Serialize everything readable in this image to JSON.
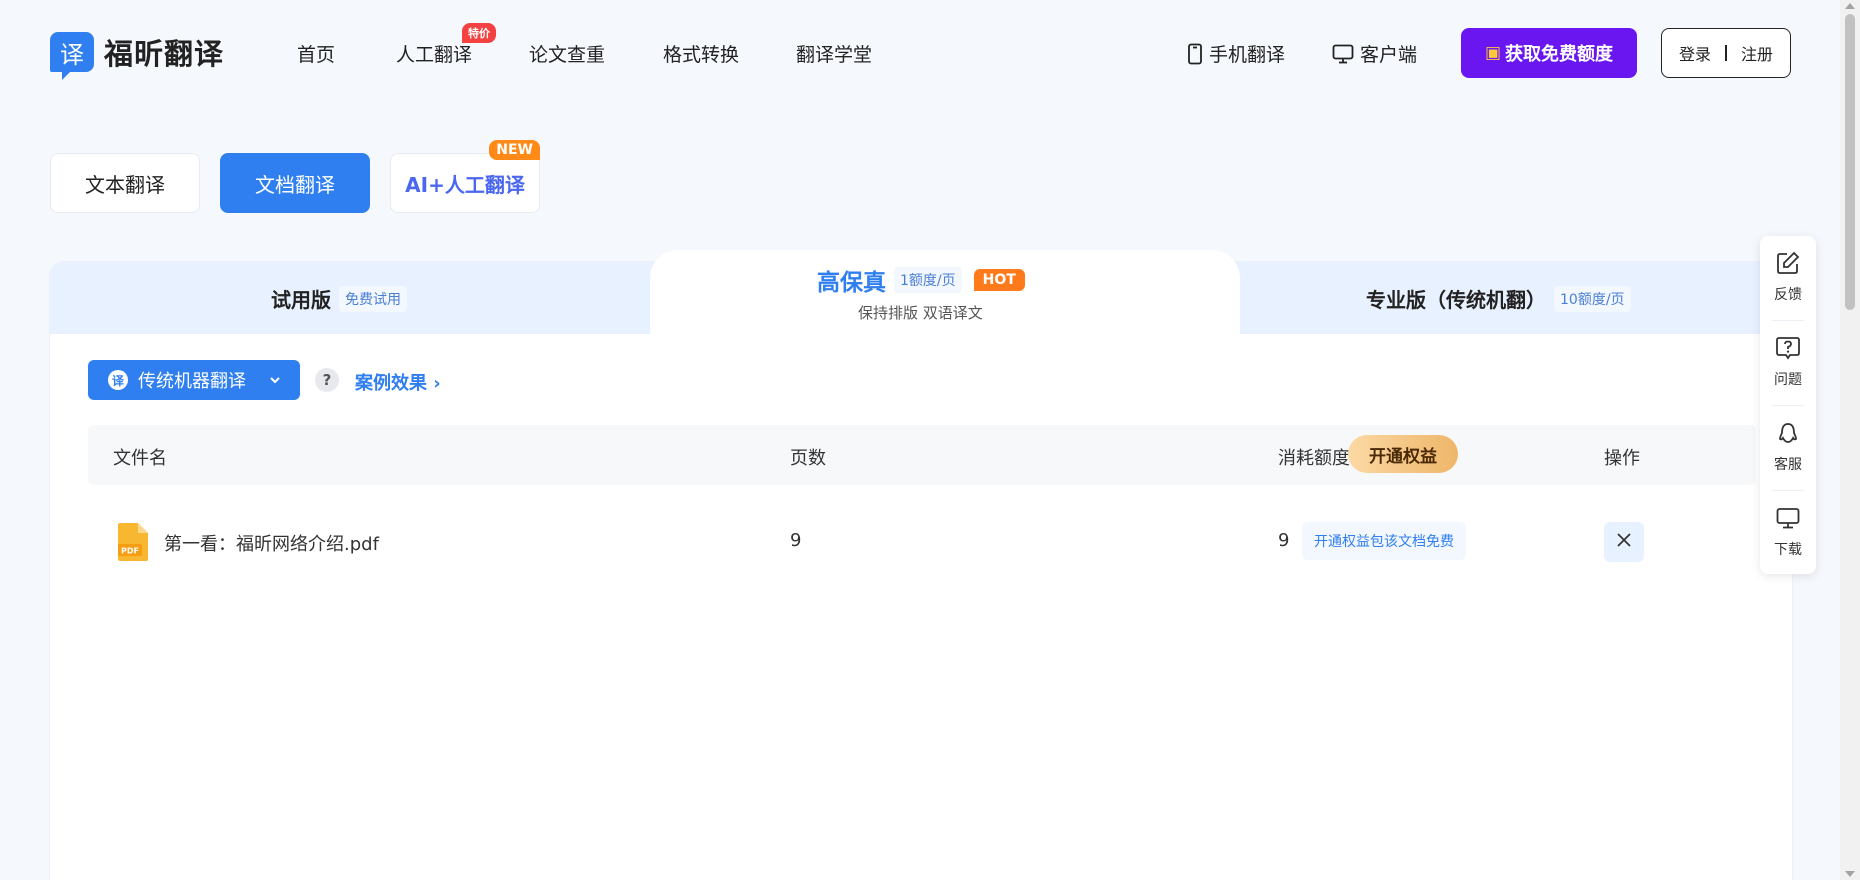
{
  "header": {
    "logo_glyph": "译",
    "logo_text": "福昕翻译",
    "nav": [
      {
        "label": "首页"
      },
      {
        "label": "人工翻译",
        "badge": "特价"
      },
      {
        "label": "论文查重"
      },
      {
        "label": "格式转换"
      },
      {
        "label": "翻译学堂"
      }
    ],
    "mobile_label": "手机翻译",
    "client_label": "客户端",
    "cta_label": "获取免费额度",
    "login_label": "登录",
    "register_label": "注册"
  },
  "modes": [
    {
      "label": "文本翻译",
      "active": false
    },
    {
      "label": "文档翻译",
      "active": true
    },
    {
      "label": "AI+人工翻译",
      "badge": "NEW"
    }
  ],
  "tiers": {
    "trial": {
      "title": "试用版",
      "tag": "免费试用"
    },
    "hifi": {
      "title": "高保真",
      "tag": "1额度/页",
      "hot": "HOT",
      "subtitle": "保持排版 双语译文"
    },
    "pro": {
      "title": "专业版（传统机翻）",
      "tag": "10额度/页"
    }
  },
  "engine": {
    "icon_glyph": "译",
    "label": "传统机器翻译",
    "help": "?",
    "case_link": "案例效果 ›"
  },
  "table": {
    "headers": {
      "name": "文件名",
      "pages": "页数",
      "cost": "消耗额度",
      "perk_button": "开通权益",
      "actions": "操作"
    },
    "rows": [
      {
        "pdf_label": "PDF",
        "name": "第一看：福昕网络介绍.pdf",
        "pages": "9",
        "cost": "9",
        "perk_note": "开通权益包该文档免费"
      }
    ]
  },
  "floatbar": [
    {
      "label": "反馈",
      "icon": "edit-icon"
    },
    {
      "label": "问题",
      "icon": "question-icon"
    },
    {
      "label": "客服",
      "icon": "headset-icon"
    },
    {
      "label": "下载",
      "icon": "monitor-icon"
    }
  ],
  "colors": {
    "primary": "#2f7ff0",
    "cta": "#6a16f0",
    "hot": "#ff7a1a",
    "badge_red": "#f44242"
  }
}
